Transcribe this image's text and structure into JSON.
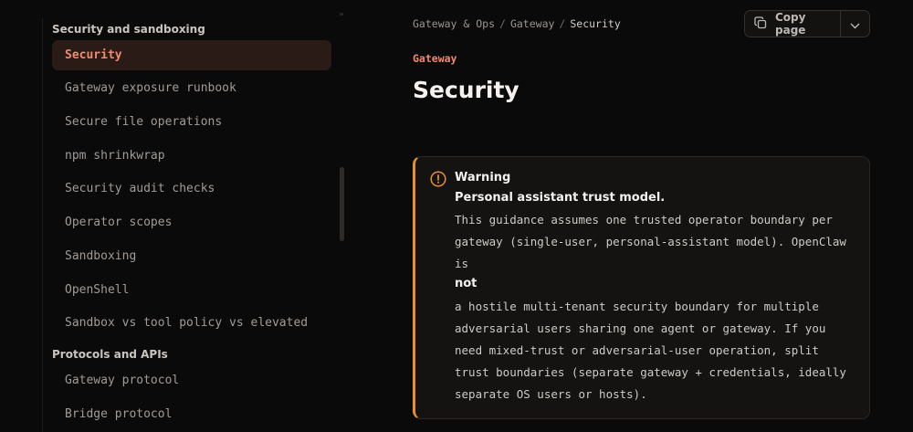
{
  "sidebar": {
    "groups": [
      {
        "title": "Security and sandboxing",
        "items": [
          {
            "label": "Security",
            "active": true
          },
          {
            "label": "Gateway exposure runbook"
          },
          {
            "label": "Secure file operations"
          },
          {
            "label": "npm shrinkwrap"
          },
          {
            "label": "Security audit checks"
          },
          {
            "label": "Operator scopes"
          },
          {
            "label": "Sandboxing"
          },
          {
            "label": "OpenShell"
          },
          {
            "label": "Sandbox vs tool policy vs elevated"
          }
        ]
      },
      {
        "title": "Protocols and APIs",
        "items": [
          {
            "label": "Gateway protocol"
          },
          {
            "label": "Bridge protocol"
          }
        ]
      }
    ]
  },
  "breadcrumb": [
    "Gateway & Ops",
    "Gateway",
    "Security"
  ],
  "toolbar": {
    "copy_label": "Copy page",
    "copy_icon": "copy-icon",
    "menu_icon": "chevron-down-icon"
  },
  "page": {
    "eyebrow": "Gateway",
    "title": "Security"
  },
  "callout": {
    "icon": "warning-icon",
    "accent": "#e8912c",
    "title": "Warning",
    "heading": "Personal assistant trust model.",
    "lines_a": [
      "This guidance assumes one trusted operator boundary per",
      "gateway (single-user, personal-assistant model). OpenClaw",
      "is"
    ],
    "emphasis": "not",
    "lines_b": [
      "a hostile multi-tenant security boundary for multiple",
      "adversarial users sharing one agent or gateway. If you",
      "need mixed-trust or adversarial-user operation, split",
      "trust boundaries (separate gateway + credentials, ideally",
      "separate OS users or hosts)."
    ]
  },
  "colors": {
    "accent": "#f08a6f",
    "active_bg": "#2a1b17",
    "background": "#0b0a0a"
  }
}
